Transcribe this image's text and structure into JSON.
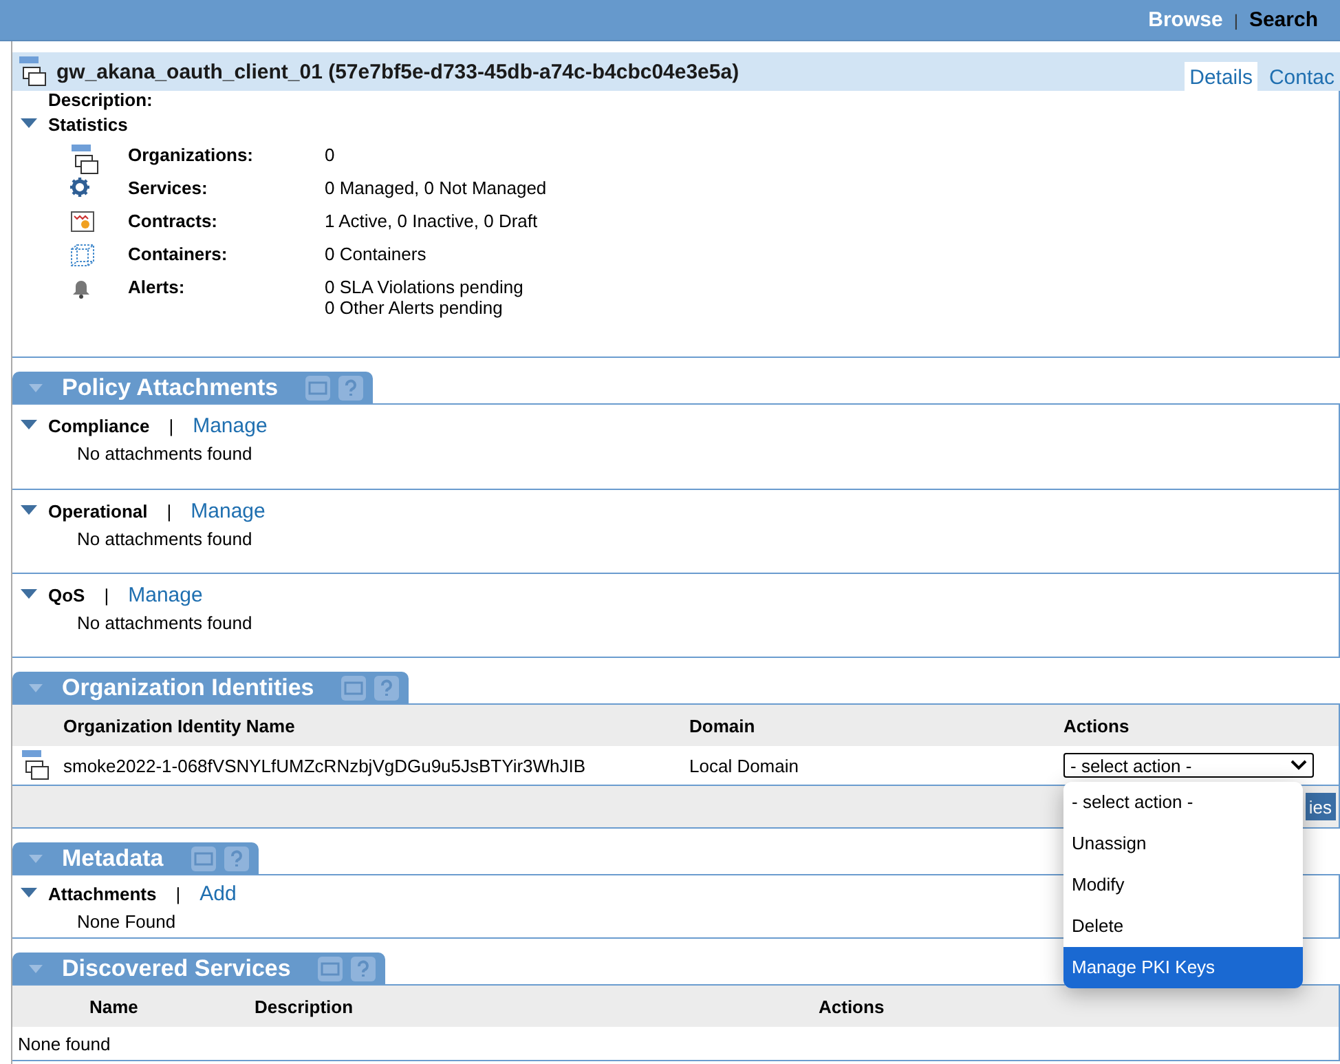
{
  "top_nav": [
    {
      "label": "Browse",
      "selected": false
    },
    {
      "label": "Search",
      "selected": true
    }
  ],
  "top_nav_separator": "|",
  "header": {
    "title": "gw_akana_oauth_client_01 (57e7bf5e-d733-45db-a74c-b4cbc04e3e5a)",
    "tabs": [
      {
        "label": "Details",
        "selected": true
      },
      {
        "label": "Contac",
        "selected": false
      }
    ]
  },
  "description_label": "Description:",
  "statistics": {
    "title": "Statistics",
    "expanded": true,
    "rows": [
      {
        "kind": "org",
        "label": "Organizations:",
        "values": [
          "0"
        ]
      },
      {
        "kind": "services",
        "label": "Services:",
        "values": [
          "0 Managed, 0 Not Managed"
        ]
      },
      {
        "kind": "contracts",
        "label": "Contracts:",
        "values": [
          "1 Active, 0 Inactive, 0 Draft"
        ]
      },
      {
        "kind": "containers",
        "label": "Containers:",
        "values": [
          "0 Containers"
        ]
      },
      {
        "kind": "alerts",
        "label": "Alerts:",
        "values": [
          "0 SLA Violations pending",
          "0 Other Alerts pending"
        ]
      }
    ]
  },
  "policy_attachments": {
    "title": "Policy Attachments",
    "groups": [
      {
        "name": "Compliance",
        "separator": "|",
        "link": "Manage",
        "expanded": true,
        "message": "No attachments found"
      },
      {
        "name": "Operational",
        "separator": "|",
        "link": "Manage",
        "expanded": true,
        "message": "No attachments found"
      },
      {
        "name": "QoS",
        "separator": "|",
        "link": "Manage",
        "expanded": true,
        "message": "No attachments found"
      }
    ]
  },
  "organization_identities": {
    "title": "Organization Identities",
    "columns": [
      "Organization Identity Name",
      "Domain",
      "Actions"
    ],
    "rows": [
      {
        "name": "smoke2022-1-068fVSNYLfUMZcRNzbjVgDGu9u5JsBTYir3WhJIB",
        "domain": "Local Domain",
        "action": "- select action -"
      }
    ],
    "footer_button": "ies",
    "dropdown": {
      "open": true,
      "options": [
        {
          "label": "- select action -",
          "selected": false
        },
        {
          "label": "Unassign",
          "selected": false
        },
        {
          "label": "Modify",
          "selected": false
        },
        {
          "label": "Delete",
          "selected": false
        },
        {
          "label": "Manage PKI Keys",
          "selected": true
        }
      ]
    }
  },
  "metadata": {
    "title": "Metadata",
    "group": "Attachments",
    "separator": "|",
    "link": "Add",
    "expanded": true,
    "message": "None Found"
  },
  "discovered_services": {
    "title": "Discovered Services",
    "columns": [
      "Name",
      "Description",
      "Actions"
    ],
    "message": "None found"
  }
}
